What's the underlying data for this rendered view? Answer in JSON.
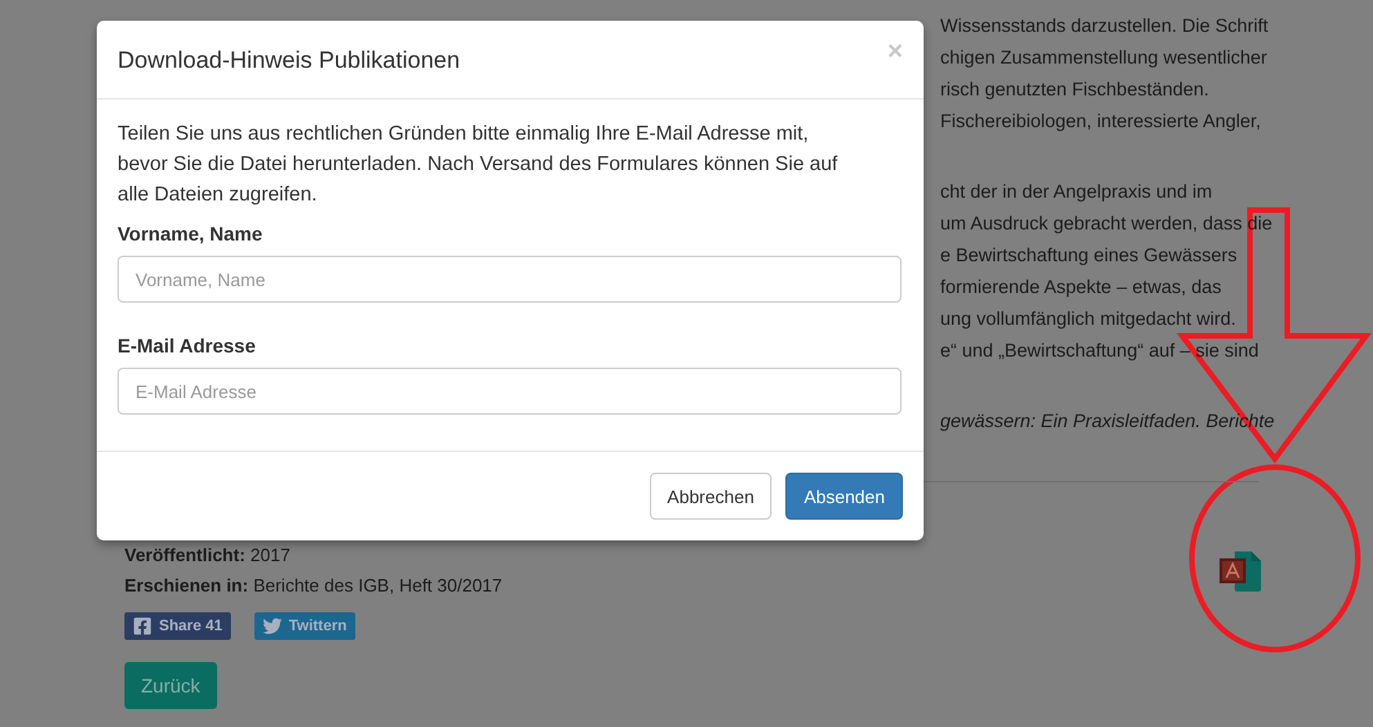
{
  "article": {
    "paragraphs": [
      {
        "kind": "text",
        "lines": [
          "Wissensstands darzustellen. Die Schrift",
          "chigen Zusammenstellung wesentlicher",
          "risch genutzten Fischbeständen.",
          "Fischereibiologen, interessierte Angler,"
        ]
      },
      {
        "kind": "text",
        "lines": [
          "cht der in der Angelpraxis und im",
          "um Ausdruck gebracht werden, dass die",
          "e Bewirtschaftung eines Gewässers",
          "formierende Aspekte – etwas, das",
          "ung vollumfänglich mitgedacht wird.",
          "e“ und „Bewirtschaftung“ auf – sie sind"
        ]
      },
      {
        "kind": "citation",
        "lines": [
          "gewässern: Ein Praxisleitfaden. Berichte"
        ]
      }
    ],
    "meta": [
      {
        "label": "Veröffentlicht:",
        "value": "2017"
      },
      {
        "label": "Erschienen in:",
        "value": "Berichte des IGB, Heft 30/2017"
      }
    ],
    "share_buttons": [
      {
        "kind": "facebook",
        "label": "Share",
        "count": "41"
      },
      {
        "kind": "twitter",
        "label": "Twittern"
      }
    ],
    "back_button": "Zurück"
  },
  "modal": {
    "title": "Download-Hinweis Publikationen",
    "close": "×",
    "intro": "Teilen Sie uns aus rechtlichen Gründen bitte einmalig Ihre E-Mail Adresse mit, bevor Sie die Datei herunterladen. Nach Versand des Formulares können Sie auf alle Dateien zugreifen.",
    "fields": [
      {
        "label": "Vorname, Name",
        "placeholder": "Vorname, Name"
      },
      {
        "label": "E-Mail Adresse",
        "placeholder": "E-Mail Adresse"
      }
    ],
    "buttons": [
      {
        "label": "Abbrechen",
        "kind": "default"
      },
      {
        "label": "Absenden",
        "kind": "primary"
      }
    ]
  }
}
